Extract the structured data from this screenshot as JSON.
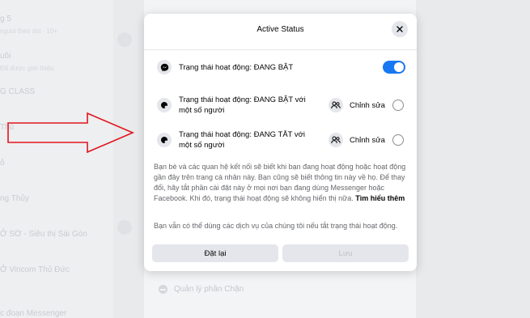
{
  "background": {
    "left_items": [
      {
        "label": "g 5",
        "sub": "nguoi theo doi · 10+",
        "meta": ""
      },
      {
        "label": "uôi",
        "sub": "Đã được giới thiệu",
        "meta": ""
      },
      {
        "label": "G CLASS",
        "sub": "",
        "meta": ""
      },
      {
        "label": "Thủ",
        "sub": "",
        "meta": ""
      },
      {
        "label": "ỏ",
        "sub": "",
        "meta": ""
      },
      {
        "label": "ng Thủy",
        "sub": "",
        "meta": ""
      },
      {
        "label": "Ở SỚ - Siêu thị Sài Gòn",
        "sub": "",
        "meta": ""
      },
      {
        "label": "Ở Vincom Thủ Đức",
        "sub": "",
        "meta": ""
      },
      {
        "label": "c đoạn Messenger",
        "sub": "",
        "meta": ""
      }
    ],
    "block_label": "Quản lý phần Chặn"
  },
  "modal": {
    "title": "Active Status",
    "options": [
      {
        "label": "Trạng thái hoạt động: ĐANG BẬT",
        "control": "toggle",
        "on": true
      },
      {
        "label": "Trạng thái hoạt động: ĐANG BẬT với một số người",
        "edit_label": "Chỉnh sửa",
        "control": "radio",
        "selected": false
      },
      {
        "label": "Trạng thái hoạt động: ĐANG TẮT với một số người",
        "edit_label": "Chỉnh sửa",
        "control": "radio",
        "selected": false
      }
    ],
    "description": "Bạn bè và các quan hệ kết nối sẽ biết khi bạn đang hoạt động hoặc hoạt động gần đây trên trang cá nhân này. Bạn cũng sẽ biết thông tin này về họ. Để thay đổi, hãy tắt phần cài đặt này ở mọi nơi bạn đang dùng Messenger hoặc Facebook. Khi đó, trạng thái hoạt động sẽ không hiển thị nữa.",
    "learn_more": "Tìm hiểu thêm",
    "note": "Bạn vẫn có thể dùng các dịch vụ của chúng tôi nếu tắt trạng thái hoạt động.",
    "reset_label": "Đặt lại",
    "save_label": "Lưu"
  },
  "colors": {
    "accent": "#1877f2",
    "arrow": "#e0161e"
  }
}
